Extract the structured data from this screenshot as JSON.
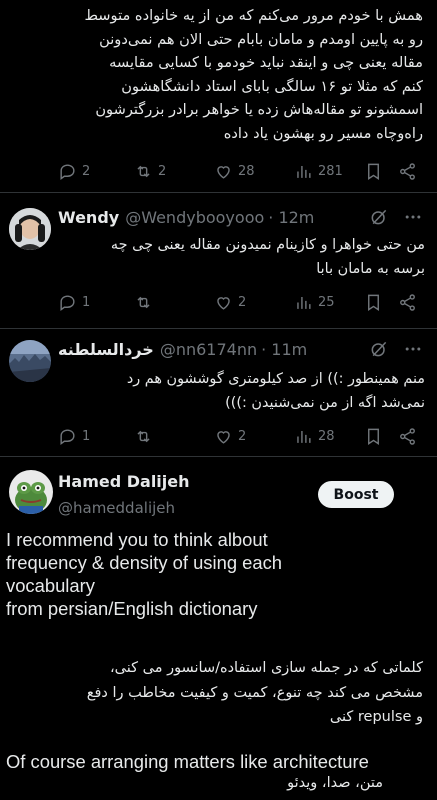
{
  "tweet1": {
    "lines": [
      "همش با خودم مرور می‌کنم که من از یه خانواده متوسط",
      "رو به پایین اومدم و مامان بابام حتی الان هم نمی‌دونن",
      "مقاله یعنی چی و اینقد نباید خودمو با کسایی مقایسه",
      "کنم که مثلا تو ۱۶ سالگی بابای استاد دانشگاهشون",
      "اسمشونو تو مقاله‌هاش زده یا خواهر برادر بزرگترشون",
      "راه‌وچاه مسیر رو بهشون یاد داده"
    ],
    "actions": {
      "replies": "2",
      "reposts": "2",
      "likes": "28",
      "views": "281"
    }
  },
  "tweet2": {
    "name": "Wendy",
    "handle": "@Wendybooyooo",
    "time": "· 12m",
    "lines": [
      "من حتی خواهرا و کازینام نمیدونن مقاله یعنی چی چه",
      "برسه به مامان بابا"
    ],
    "actions": {
      "replies": "1",
      "reposts": "",
      "likes": "2",
      "views": "25"
    }
  },
  "tweet3": {
    "name": "خردالسلطنه",
    "handle": "@nn6174nn",
    "time": "· 11m",
    "lines": [
      "منم همینطور :)) از صد کیلومتری گوششون هم رد",
      "نمی‌شد اگه از من نمی‌شنیدن :)))"
    ],
    "actions": {
      "replies": "1",
      "reposts": "",
      "likes": "2",
      "views": "28"
    }
  },
  "ad": {
    "name": "Hamed Dalijeh",
    "handle": "@hameddalijeh",
    "boost_label": "Boost",
    "en_lines": [
      "I recommend you to think albout",
      "frequency & density of using each",
      "vocabulary",
      "from persian/English dictionary"
    ],
    "fa_lines": [
      "کلماتی که در جمله سازی استفاده/سانسور می کنی،",
      "مشخص می کند چه تنوع، کمیت و کیفیت مخاطب را دفع",
      "و repulse کنی"
    ],
    "en2_line": "Of course arranging matters like architecture",
    "fa2_line": "متن، صدا، ویدئو"
  },
  "colors": {
    "background": "#000000",
    "text": "#e7e9ea",
    "muted": "#71767b",
    "divider": "#2f3336",
    "boost_bg": "#eff3f4"
  }
}
